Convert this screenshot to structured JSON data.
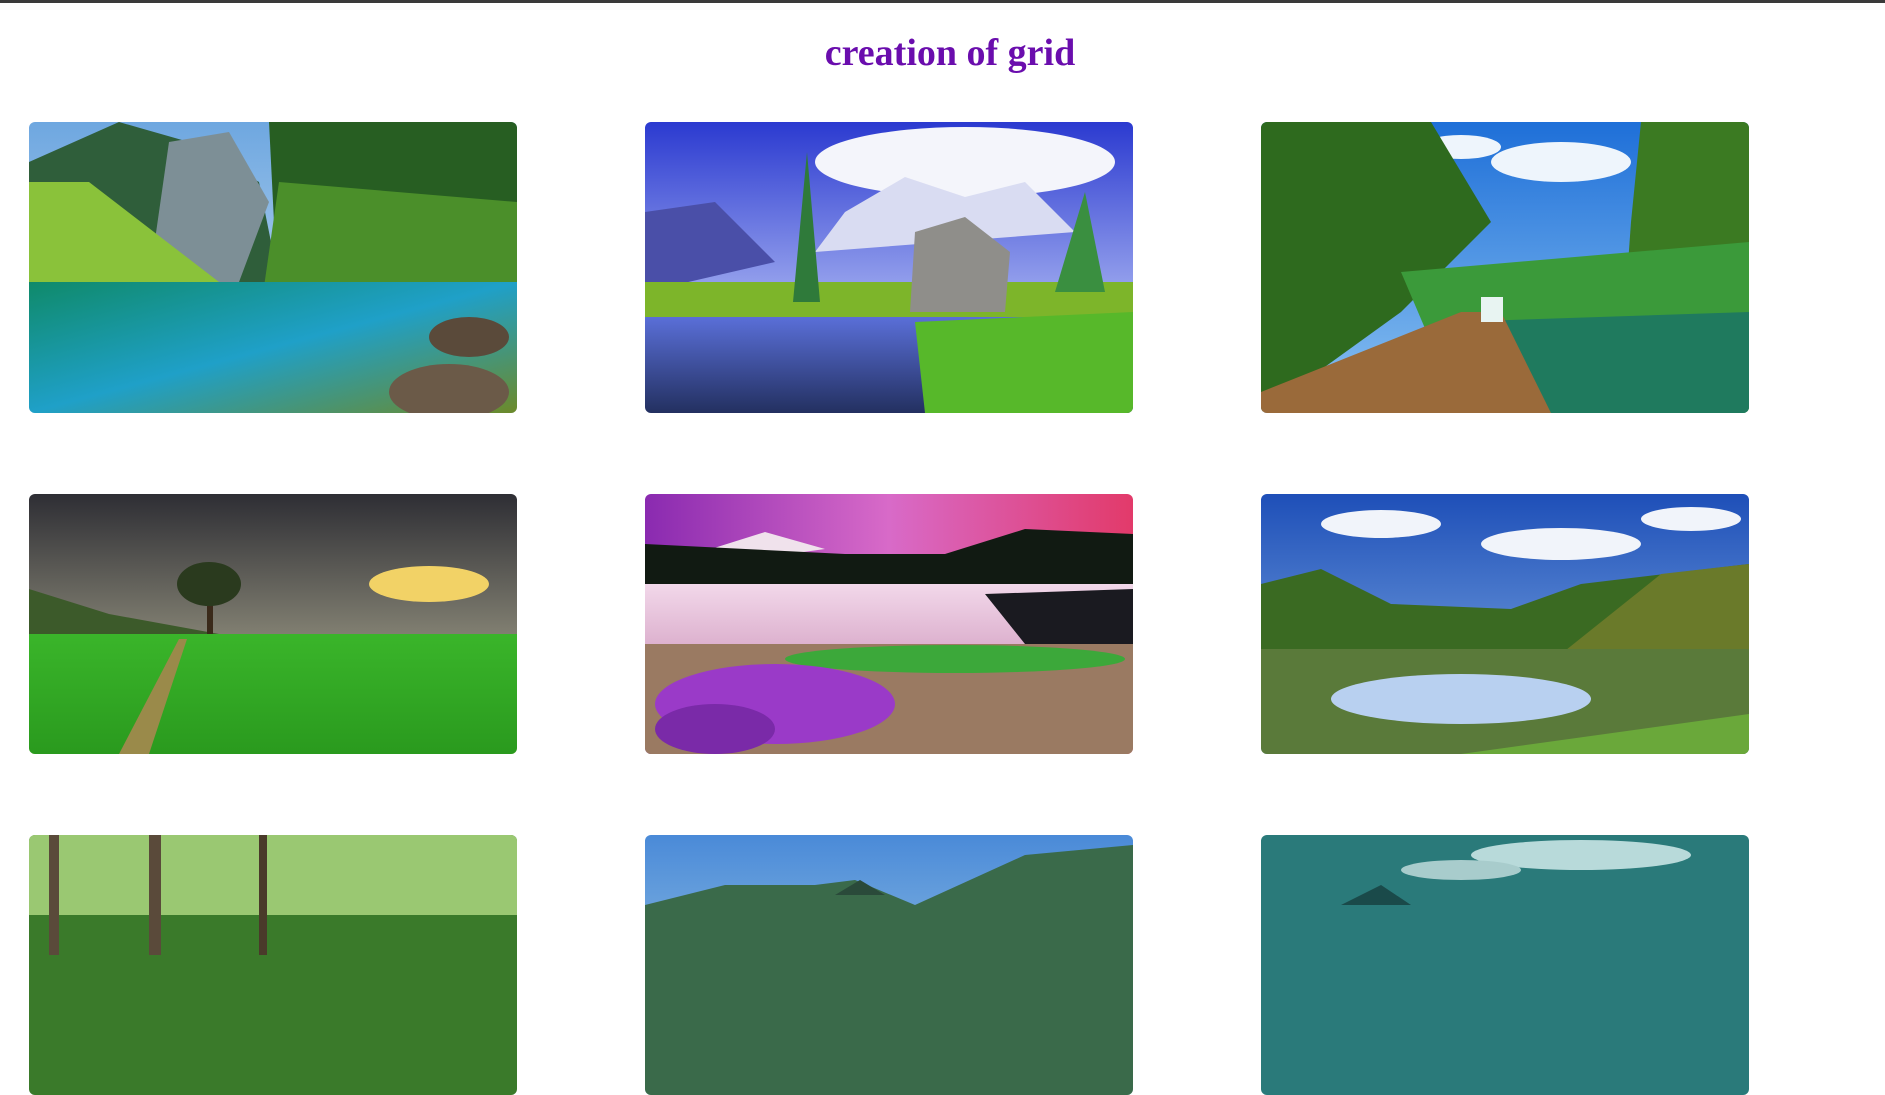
{
  "header": {
    "title": "creation of grid",
    "title_color": "#6a0dad"
  },
  "gallery": {
    "images": [
      {
        "name": "mountain-lake-forest-image"
      },
      {
        "name": "alpine-stream-rock-image"
      },
      {
        "name": "wooden-boardwalk-waterfall-image"
      },
      {
        "name": "lone-tree-green-field-image"
      },
      {
        "name": "pink-sky-lake-flowers-image"
      },
      {
        "name": "reflective-lake-clouds-image"
      },
      {
        "name": "forest-path-image"
      },
      {
        "name": "blue-mountains-image"
      },
      {
        "name": "teal-sky-image"
      }
    ]
  }
}
